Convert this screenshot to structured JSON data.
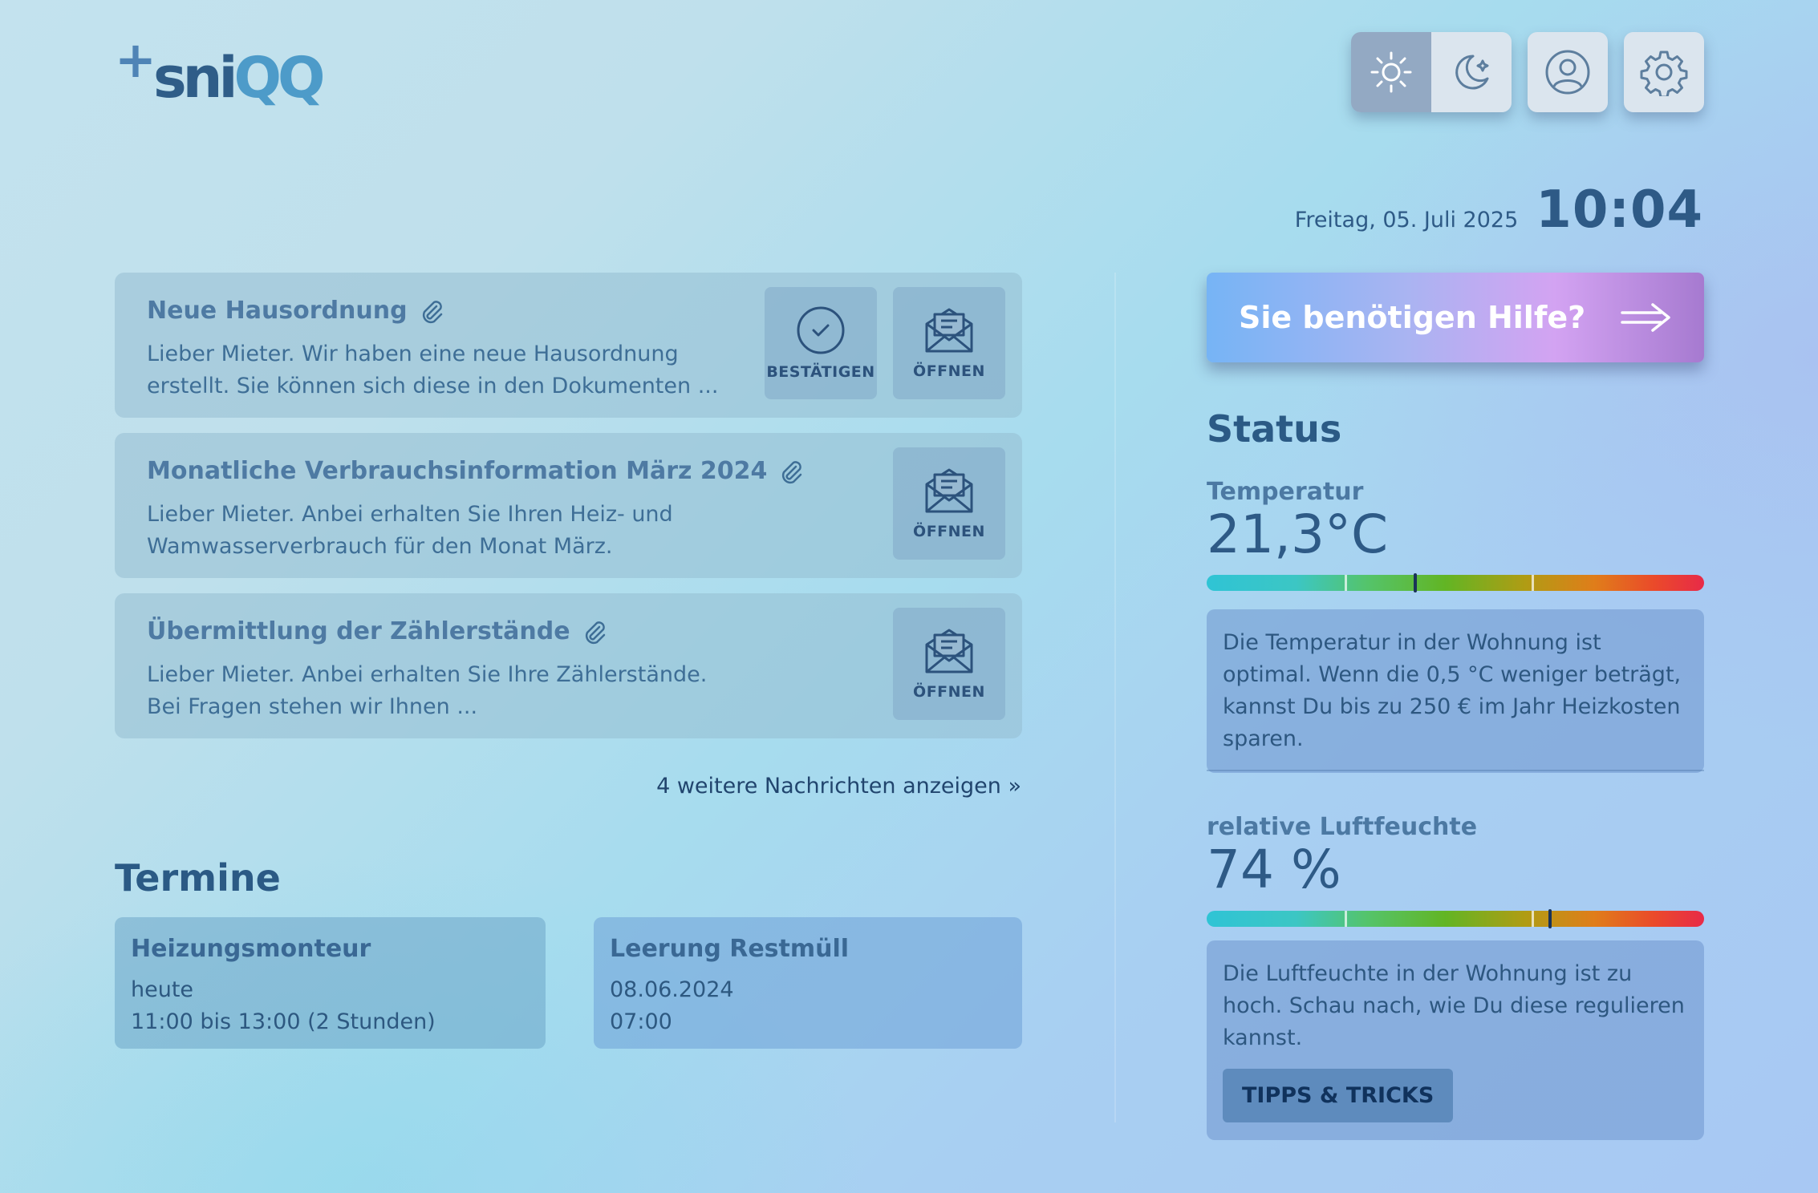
{
  "brand": {
    "logo_plus": "+",
    "logo_text": "sni",
    "logo_accent": "QQ"
  },
  "header": {
    "theme_light_icon": "sun-icon",
    "theme_dark_icon": "moon-icon",
    "profile_icon": "user-icon",
    "settings_icon": "gear-icon",
    "date": "Freitag, 05. Juli 2025",
    "time": "10:04"
  },
  "messages": [
    {
      "title": "Neue Hausordnung",
      "body": "Lieber Mieter. Wir haben eine neue Hausordnung erstellt. Sie können sich diese in den Dokumenten ...",
      "confirm_label": "BESTÄTIGEN",
      "open_label": "ÖFFNEN"
    },
    {
      "title": "Monatliche Verbrauchsinformation März 2024",
      "body": "Lieber Mieter. Anbei erhalten Sie Ihren Heiz- und Wamwasserverbrauch für den Monat März.",
      "open_label": "ÖFFNEN"
    },
    {
      "title": "Übermittlung der Zählerstände",
      "body": "Lieber Mieter. Anbei erhalten Sie Ihre Zählerstände. Bei Fragen stehen wir Ihnen ...",
      "open_label": "ÖFFNEN"
    }
  ],
  "more_messages_link": "4 weitere Nachrichten anzeigen »",
  "appointments": {
    "title": "Termine",
    "items": [
      {
        "title": "Heizungsmonteur",
        "line1": "heute",
        "line2": "11:00 bis 13:00 (2 Stunden)"
      },
      {
        "title": "Leerung Restmüll",
        "line1": "08.06.2024",
        "line2": "07:00"
      }
    ]
  },
  "help_button": "Sie benötigen Hilfe?",
  "status": {
    "title": "Status",
    "temperature": {
      "label": "Temperatur",
      "value": "21,3°C",
      "scale_position_pct": 42,
      "info": "Die Temperatur in der Wohnung ist optimal. Wenn die 0,5 °C weniger beträgt, kannst Du bis zu 250 € im Jahr Heizkosten sparen."
    },
    "humidity": {
      "label": "relative Luftfeuchte",
      "value": "74 %",
      "scale_position_pct": 69,
      "info": "Die Luftfeuchte in der Wohnung ist zu hoch. Schau nach, wie Du diese regulieren kannst.",
      "tips_button": "TIPPS & TRICKS"
    }
  }
}
